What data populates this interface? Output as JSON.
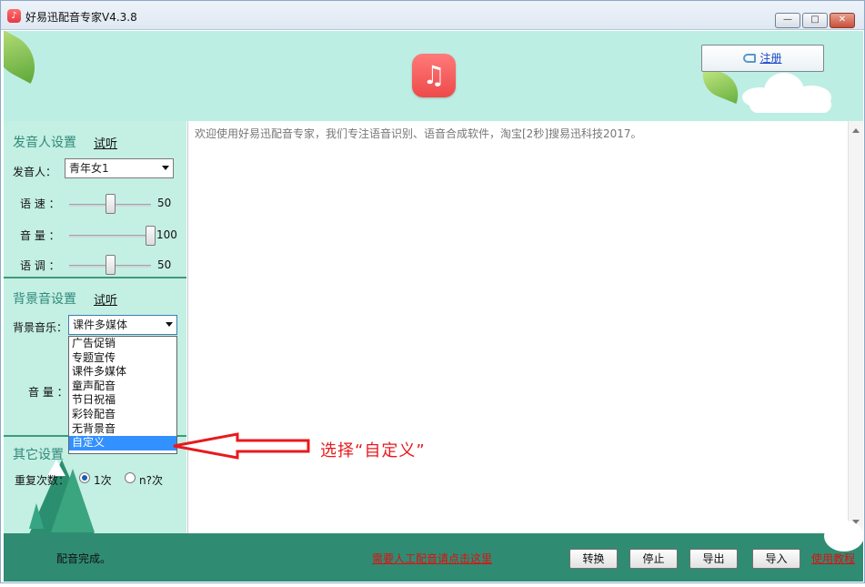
{
  "window": {
    "title": "好易迅配音专家V4.3.8",
    "controls": {
      "minimize": "—",
      "maximize": "□",
      "close": "✕"
    }
  },
  "header": {
    "logo_icon": "music-note-icon",
    "logo_glyph": "♫",
    "register_label": "注册",
    "register_icon": "key-icon"
  },
  "voice_settings": {
    "title": "发音人设置",
    "listen": "试听",
    "speaker_label": "发音人：",
    "speaker_value": "青年女1",
    "speed_label": "语 速 ：",
    "speed_value": "50",
    "speed_fraction": 0.5,
    "volume_label": "音 量 ：",
    "volume_value": "100",
    "volume_fraction": 1.0,
    "pitch_label": "语 调 ：",
    "pitch_value": "50",
    "pitch_fraction": 0.5
  },
  "bg_settings": {
    "title": "背景音设置",
    "listen": "试听",
    "music_label": "背景音乐：",
    "music_value": "课件多媒体",
    "volume_label": "音 量 ：",
    "options": [
      "广告促销",
      "专题宣传",
      "课件多媒体",
      "童声配音",
      "节日祝福",
      "彩铃配音",
      "无背景音",
      "自定义"
    ],
    "highlighted_index": 7
  },
  "other_settings": {
    "title": "其它设置",
    "repeat_label": "重复次数：",
    "option_once": "1次",
    "option_n": "n?次"
  },
  "editor": {
    "text": "欢迎使用好易迅配音专家，我们专注语音识别、语音合成软件，淘宝[2秒]搜易迅科技2017。"
  },
  "bottom": {
    "status": "配音完成。",
    "manual_link": "需要人工配音请点击这里",
    "convert": "转换",
    "stop": "停止",
    "export": "导出",
    "import": "导入",
    "tutorial": "使用教程"
  },
  "annotation": {
    "text": "选择“自定义”",
    "color": "#e8191e"
  },
  "colors": {
    "panel": "#c4efe3",
    "banner": "#bdeee3",
    "bottombar": "#2f8c73",
    "accent": "#2e8a7a",
    "link_red": "#d11111"
  }
}
